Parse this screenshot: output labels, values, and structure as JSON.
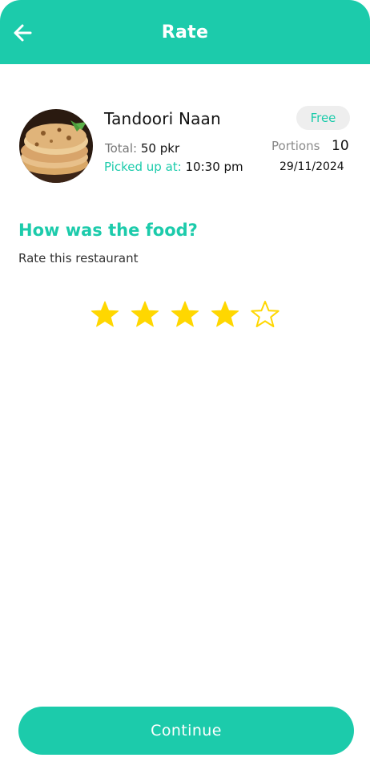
{
  "header": {
    "title": "Rate"
  },
  "order": {
    "food_name": "Tandoori Naan",
    "badge": "Free",
    "total_label": "Total:",
    "total_value": "50 pkr",
    "pickup_label": "Picked up at:",
    "pickup_time": "10:30 pm",
    "portions_label": "Portions",
    "portions_value": "10",
    "date": "29/11/2024"
  },
  "feedback": {
    "question": "How was the food?",
    "subtext": "Rate this restaurant",
    "rating": 4,
    "max_rating": 5
  },
  "actions": {
    "continue_label": "Continue"
  },
  "colors": {
    "accent": "#1ccbab",
    "star": "#ffd700"
  }
}
